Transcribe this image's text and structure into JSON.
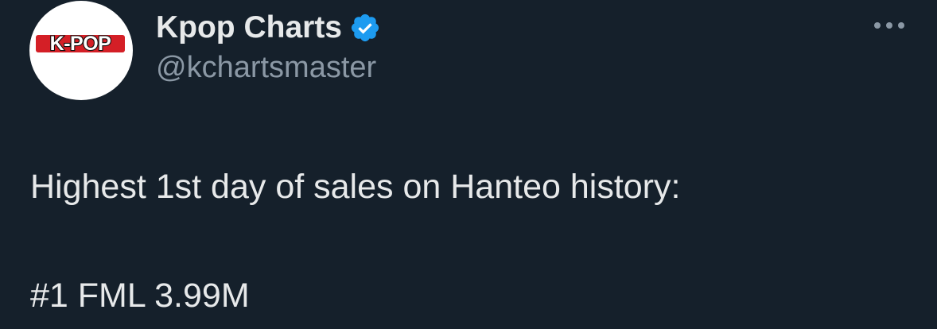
{
  "tweet": {
    "author": {
      "avatar_text": "K-POP",
      "display_name": "Kpop Charts",
      "handle": "@kchartsmaster",
      "verified_icon": "verified-badge-icon",
      "verified_color": "#1d9bf0"
    },
    "more_icon": "more-options-icon",
    "body": {
      "line1": "Highest 1st day of sales on Hanteo history:",
      "line2": "#1 FML 3.99M"
    }
  },
  "colors": {
    "background": "#15202b",
    "primary_text": "#e7e9ea",
    "secondary_text": "#8b98a5",
    "logo_red": "#d41f26"
  }
}
